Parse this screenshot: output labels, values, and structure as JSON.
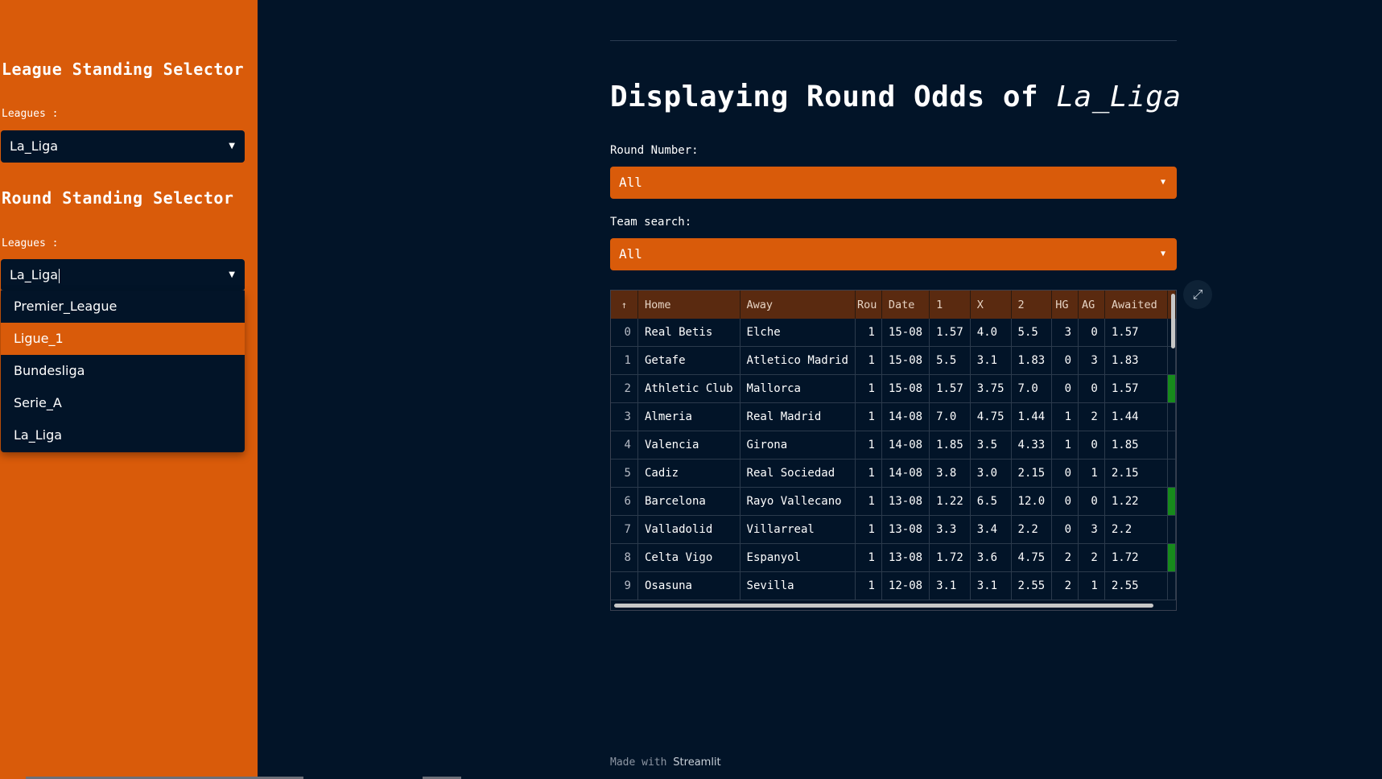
{
  "sidebar": {
    "league_title": "League Standing Selector",
    "league_label": "Leagues :",
    "league_value": "La_Liga",
    "round_title": "Round Standing Selector",
    "round_label": "Leagues :",
    "round_value": "La_Liga",
    "dropdown_options": [
      "Premier_League",
      "Ligue_1",
      "Bundesliga",
      "Serie_A",
      "La_Liga"
    ],
    "dropdown_highlighted": "Ligue_1"
  },
  "main": {
    "title_prefix": "Displaying Round Odds of ",
    "title_league": "La_Liga",
    "round_label": "Round Number:",
    "round_value": "All",
    "team_label": "Team search:",
    "team_value": "All"
  },
  "table": {
    "sort_icon": "↑",
    "columns": [
      "Home",
      "Away",
      "Rou",
      "Date",
      "1",
      "X",
      "2",
      "HG",
      "AG",
      "Awaited"
    ],
    "rows": [
      {
        "i": "0",
        "home": "Real Betis",
        "away": "Elche",
        "round": "1",
        "date": "15-08",
        "o1": "1.57",
        "ox": "4.0",
        "o2": "5.5",
        "hg": "3",
        "ag": "0",
        "awaited": "1.57",
        "extra": "green-no"
      },
      {
        "i": "1",
        "home": "Getafe",
        "away": "Atletico Madrid",
        "round": "1",
        "date": "15-08",
        "o1": "5.5",
        "ox": "3.1",
        "o2": "1.83",
        "hg": "0",
        "ag": "3",
        "awaited": "1.83",
        "extra": "green-no"
      },
      {
        "i": "2",
        "home": "Athletic Club",
        "away": "Mallorca",
        "round": "1",
        "date": "15-08",
        "o1": "1.57",
        "ox": "3.75",
        "o2": "7.0",
        "hg": "0",
        "ag": "0",
        "awaited": "1.57",
        "extra": "green-yes"
      },
      {
        "i": "3",
        "home": "Almeria",
        "away": "Real Madrid",
        "round": "1",
        "date": "14-08",
        "o1": "7.0",
        "ox": "4.75",
        "o2": "1.44",
        "hg": "1",
        "ag": "2",
        "awaited": "1.44",
        "extra": "green-no"
      },
      {
        "i": "4",
        "home": "Valencia",
        "away": "Girona",
        "round": "1",
        "date": "14-08",
        "o1": "1.85",
        "ox": "3.5",
        "o2": "4.33",
        "hg": "1",
        "ag": "0",
        "awaited": "1.85",
        "extra": "green-no"
      },
      {
        "i": "5",
        "home": "Cadiz",
        "away": "Real Sociedad",
        "round": "1",
        "date": "14-08",
        "o1": "3.8",
        "ox": "3.0",
        "o2": "2.15",
        "hg": "0",
        "ag": "1",
        "awaited": "2.15",
        "extra": "green-no"
      },
      {
        "i": "6",
        "home": "Barcelona",
        "away": "Rayo Vallecano",
        "round": "1",
        "date": "13-08",
        "o1": "1.22",
        "ox": "6.5",
        "o2": "12.0",
        "hg": "0",
        "ag": "0",
        "awaited": "1.22",
        "extra": "green-yes"
      },
      {
        "i": "7",
        "home": "Valladolid",
        "away": "Villarreal",
        "round": "1",
        "date": "13-08",
        "o1": "3.3",
        "ox": "3.4",
        "o2": "2.2",
        "hg": "0",
        "ag": "3",
        "awaited": "2.2",
        "extra": "green-no"
      },
      {
        "i": "8",
        "home": "Celta Vigo",
        "away": "Espanyol",
        "round": "1",
        "date": "13-08",
        "o1": "1.72",
        "ox": "3.6",
        "o2": "4.75",
        "hg": "2",
        "ag": "2",
        "awaited": "1.72",
        "extra": "green-yes"
      },
      {
        "i": "9",
        "home": "Osasuna",
        "away": "Sevilla",
        "round": "1",
        "date": "12-08",
        "o1": "3.1",
        "ox": "3.1",
        "o2": "2.55",
        "hg": "2",
        "ag": "1",
        "awaited": "2.55",
        "extra": "green-no"
      }
    ]
  },
  "footer": {
    "prefix": "Made with ",
    "brand": "Streamlit"
  },
  "colors": {
    "accent": "#d95b0a",
    "background": "#021428",
    "highlight": "#178a1c"
  },
  "icons": {
    "caret": "caret-down-icon",
    "expand": "expand-icon",
    "sort": "sort-ascending-icon"
  }
}
